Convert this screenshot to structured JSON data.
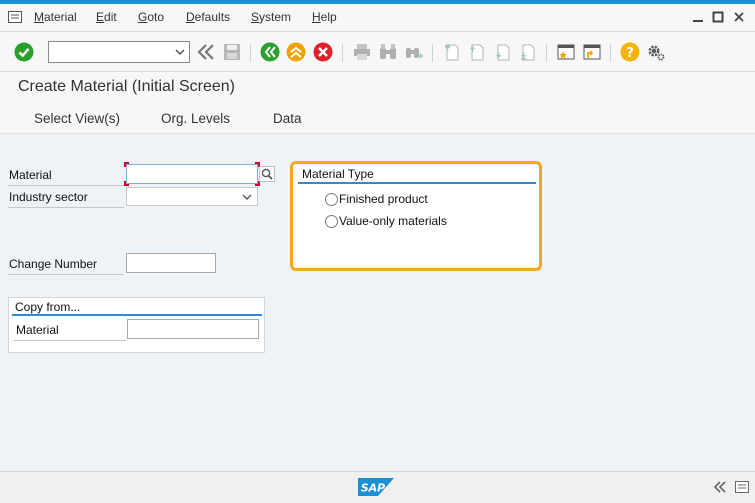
{
  "menubar": {
    "items": [
      {
        "first": "M",
        "rest": "aterial"
      },
      {
        "first": "E",
        "rest": "dit"
      },
      {
        "first": "G",
        "rest": "oto"
      },
      {
        "first": "D",
        "rest": "efaults"
      },
      {
        "first": "S",
        "rest": "ystem"
      },
      {
        "first": "H",
        "rest": "elp"
      }
    ]
  },
  "toolbar": {
    "command_field_value": ""
  },
  "page": {
    "title": "Create Material (Initial Screen)"
  },
  "app_toolbar": {
    "buttons": [
      "Select View(s)",
      "Org. Levels",
      "Data"
    ]
  },
  "form": {
    "material_label": "Material",
    "material_value": "",
    "industry_sector_label": "Industry sector",
    "industry_sector_value": "",
    "change_number_label": "Change Number",
    "change_number_value": ""
  },
  "material_type": {
    "title": "Material Type",
    "options": [
      {
        "label": "Finished product",
        "selected": false
      },
      {
        "label": "Value-only materials",
        "selected": false
      }
    ]
  },
  "copy_from": {
    "title": "Copy from...",
    "material_label": "Material",
    "material_value": ""
  },
  "colors": {
    "accent_blue": "#1a8fd6",
    "highlight_orange": "#f5a623",
    "enter_green": "#2ca02c",
    "cancel_red": "#e0212e",
    "exit_orange": "#f0a30a",
    "help_yellow": "#f3b400"
  }
}
